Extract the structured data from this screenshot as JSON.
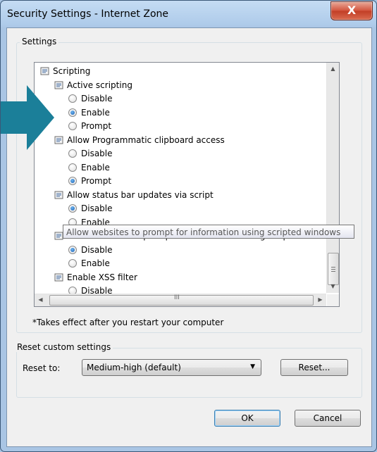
{
  "window": {
    "title": "Security Settings - Internet Zone",
    "close_glyph": "X"
  },
  "settings_group": {
    "label": "Settings"
  },
  "tree": [
    {
      "type": "category",
      "label": "Scripting"
    },
    {
      "type": "setting",
      "label": "Active scripting"
    },
    {
      "type": "option",
      "label": "Disable",
      "checked": false
    },
    {
      "type": "option",
      "label": "Enable",
      "checked": true
    },
    {
      "type": "option",
      "label": "Prompt",
      "checked": false
    },
    {
      "type": "setting",
      "label": "Allow Programmatic clipboard access"
    },
    {
      "type": "option",
      "label": "Disable",
      "checked": false
    },
    {
      "type": "option",
      "label": "Enable",
      "checked": false
    },
    {
      "type": "option",
      "label": "Prompt",
      "checked": true
    },
    {
      "type": "setting",
      "label": "Allow status bar updates via script"
    },
    {
      "type": "option",
      "label": "Disable",
      "checked": true
    },
    {
      "type": "option",
      "label": "Enable",
      "checked": false
    },
    {
      "type": "setting",
      "label": "Allow websites to prompt for information using scripted windows"
    },
    {
      "type": "option",
      "label": "Disable",
      "checked": true
    },
    {
      "type": "option",
      "label": "Enable",
      "checked": false
    },
    {
      "type": "setting",
      "label": "Enable XSS filter"
    },
    {
      "type": "option",
      "label": "Disable",
      "checked": false
    }
  ],
  "tooltip": "Allow websites to prompt for information using scripted windows",
  "scrollbar": {
    "thumb_glyph": "III"
  },
  "note": "*Takes effect after you restart your computer",
  "reset_group": {
    "label": "Reset custom settings",
    "reset_to_label": "Reset to:",
    "selected_value": "Medium-high (default)",
    "reset_button": "Reset..."
  },
  "buttons": {
    "ok": "OK",
    "cancel": "Cancel"
  },
  "colors": {
    "accent_arrow": "#1b7f99",
    "title_bar": "#aecbea",
    "close_button": "#c8462d"
  },
  "icons": {
    "setting": "settings-page-icon",
    "close": "close-icon",
    "arrow": "teal-pointer-arrow"
  }
}
